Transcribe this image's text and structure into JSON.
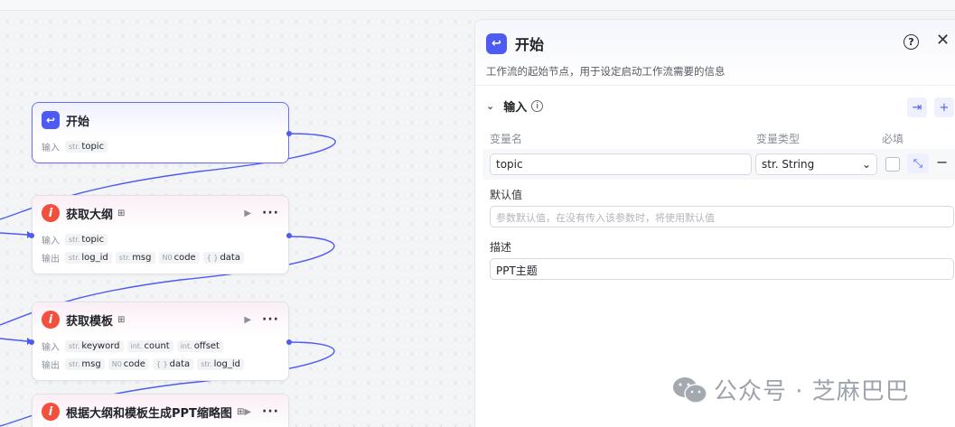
{
  "canvas": {
    "nodes": [
      {
        "id": "start",
        "title": "开始",
        "input_label": "输入",
        "inputs": [
          {
            "type": "str.",
            "name": "topic"
          }
        ]
      },
      {
        "id": "outline",
        "title": "获取大纲",
        "input_label": "输入",
        "output_label": "输出",
        "inputs": [
          {
            "type": "str.",
            "name": "topic"
          }
        ],
        "outputs": [
          {
            "type": "str.",
            "name": "log_id"
          },
          {
            "type": "str.",
            "name": "msg"
          },
          {
            "type": "N0",
            "name": "code"
          },
          {
            "type": "{ }",
            "name": "data"
          }
        ]
      },
      {
        "id": "template",
        "title": "获取模板",
        "input_label": "输入",
        "output_label": "输出",
        "inputs": [
          {
            "type": "str.",
            "name": "keyword"
          },
          {
            "type": "int.",
            "name": "count"
          },
          {
            "type": "int.",
            "name": "offset"
          }
        ],
        "outputs": [
          {
            "type": "str.",
            "name": "msg"
          },
          {
            "type": "N0",
            "name": "code"
          },
          {
            "type": "{ }",
            "name": "data"
          },
          {
            "type": "str.",
            "name": "log_id"
          }
        ]
      },
      {
        "id": "thumbnail",
        "title": "根据大纲和模板生成PPT缩略图"
      }
    ]
  },
  "panel": {
    "title": "开始",
    "description": "工作流的起始节点，用于设定启动工作流需要的信息",
    "section_title": "输入",
    "columns": {
      "name": "变量名",
      "type": "变量类型",
      "required": "必填"
    },
    "variable": {
      "name": "topic",
      "type": "str. String",
      "required": false,
      "default_label": "默认值",
      "default_placeholder": "参数默认值，在没有传入该参数时，将使用默认值",
      "desc_label": "描述",
      "desc_value": "PPT主题"
    }
  },
  "watermark": "公众号 · 芝麻巴巴",
  "colors": {
    "accent": "#4e5bf2",
    "plugin": "#f0503c",
    "edge": "#4e5bf2"
  }
}
